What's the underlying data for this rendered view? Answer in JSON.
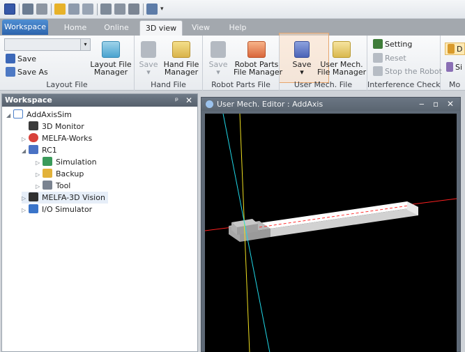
{
  "colors": {
    "accent": "#2d64ad",
    "highlight": "#e6a56d",
    "viewport_bg": "#000000",
    "axis_x": "#ff2020",
    "axis_y": "#f0e020",
    "axis_z": "#20d8e8"
  },
  "quick_access": {
    "icons": [
      "app-logo-icon",
      "save-icon",
      "print-icon",
      "layout-icon",
      "chart-icon",
      "chart2-icon",
      "tile-icon",
      "list-icon",
      "bars-icon",
      "view-icon",
      "dropdown-arrow-icon"
    ]
  },
  "tabs": {
    "workspace": "Workspace",
    "home": "Home",
    "online": "Online",
    "view3d": "3D view",
    "view": "View",
    "help": "Help"
  },
  "ribbon": {
    "layout_file": {
      "label": "Layout File",
      "save": "Save",
      "save_as": "Save As",
      "manager_line1": "Layout File",
      "manager_line2": "Manager"
    },
    "hand_file": {
      "label": "Hand File",
      "save": "Save",
      "save_arrow": "▾",
      "manager_line1": "Hand File",
      "manager_line2": "Manager"
    },
    "robot_parts_file": {
      "label": "Robot Parts File",
      "save": "Save",
      "save_arrow": "▾",
      "manager_line1": "Robot Parts",
      "manager_line2": "File Manager"
    },
    "user_mech_file": {
      "label": "User Mech. File",
      "save": "Save",
      "save_arrow": "▾",
      "manager_line1": "User Mech.",
      "manager_line2": "File Manager"
    },
    "interference_check": {
      "label": "Interference Check",
      "setting": "Setting",
      "reset": "Reset",
      "stop": "Stop the Robot"
    },
    "next_group": {
      "label": "Mo",
      "item1": "D",
      "item2": "Si"
    }
  },
  "workspace": {
    "title": "Workspace",
    "pin": "ᵖ",
    "close": "✕",
    "tree": [
      {
        "label": "AddAxisSim",
        "expander": "◢",
        "icon": "project-icon"
      },
      {
        "label": "3D Monitor",
        "expander": "",
        "icon": "monitor-icon"
      },
      {
        "label": "MELFA-Works",
        "expander": "▷",
        "icon": "melfa-works-icon"
      },
      {
        "label": "RC1",
        "expander": "◢",
        "icon": "robot-controller-icon"
      },
      {
        "label": "Simulation",
        "expander": "▷",
        "icon": "simulation-icon"
      },
      {
        "label": "Backup",
        "expander": "▷",
        "icon": "backup-icon"
      },
      {
        "label": "Tool",
        "expander": "▷",
        "icon": "tool-icon"
      },
      {
        "label": "MELFA-3D Vision",
        "expander": "▷",
        "icon": "vision-icon"
      },
      {
        "label": "I/O Simulator",
        "expander": "▷",
        "icon": "io-simulator-icon"
      }
    ]
  },
  "editor": {
    "title": "User Mech. Editor : AddAxis",
    "minimize": "‒",
    "maximize": "▫",
    "close": "✕"
  }
}
